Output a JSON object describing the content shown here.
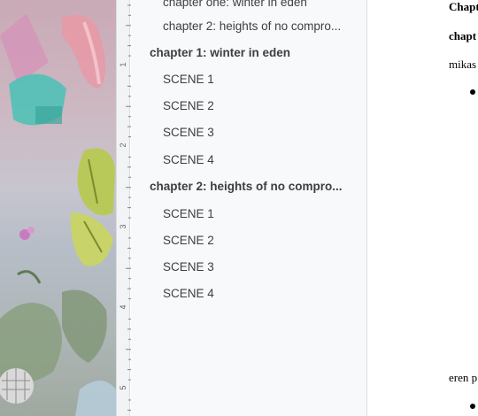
{
  "outline": {
    "items": [
      {
        "label": "chapter one: winter in eden",
        "level": 2
      },
      {
        "label": "chapter 2: heights of no compro...",
        "level": 2
      },
      {
        "label": "chapter 1: winter in eden",
        "level": 1
      },
      {
        "label": "SCENE 1",
        "level": 2
      },
      {
        "label": "SCENE 2",
        "level": 2
      },
      {
        "label": "SCENE 3",
        "level": 2
      },
      {
        "label": "SCENE 4",
        "level": 2
      },
      {
        "label": "chapter 2: heights of no compro...",
        "level": 1
      },
      {
        "label": "SCENE 1",
        "level": 2
      },
      {
        "label": "SCENE 2",
        "level": 2
      },
      {
        "label": "SCENE 3",
        "level": 2
      },
      {
        "label": "SCENE 4",
        "level": 2
      }
    ]
  },
  "ruler": {
    "numbers": [
      "1",
      "2",
      "3",
      "4",
      "5"
    ]
  },
  "document": {
    "lines": [
      "Chapt",
      "chapt",
      "mikas",
      "eren p"
    ]
  }
}
